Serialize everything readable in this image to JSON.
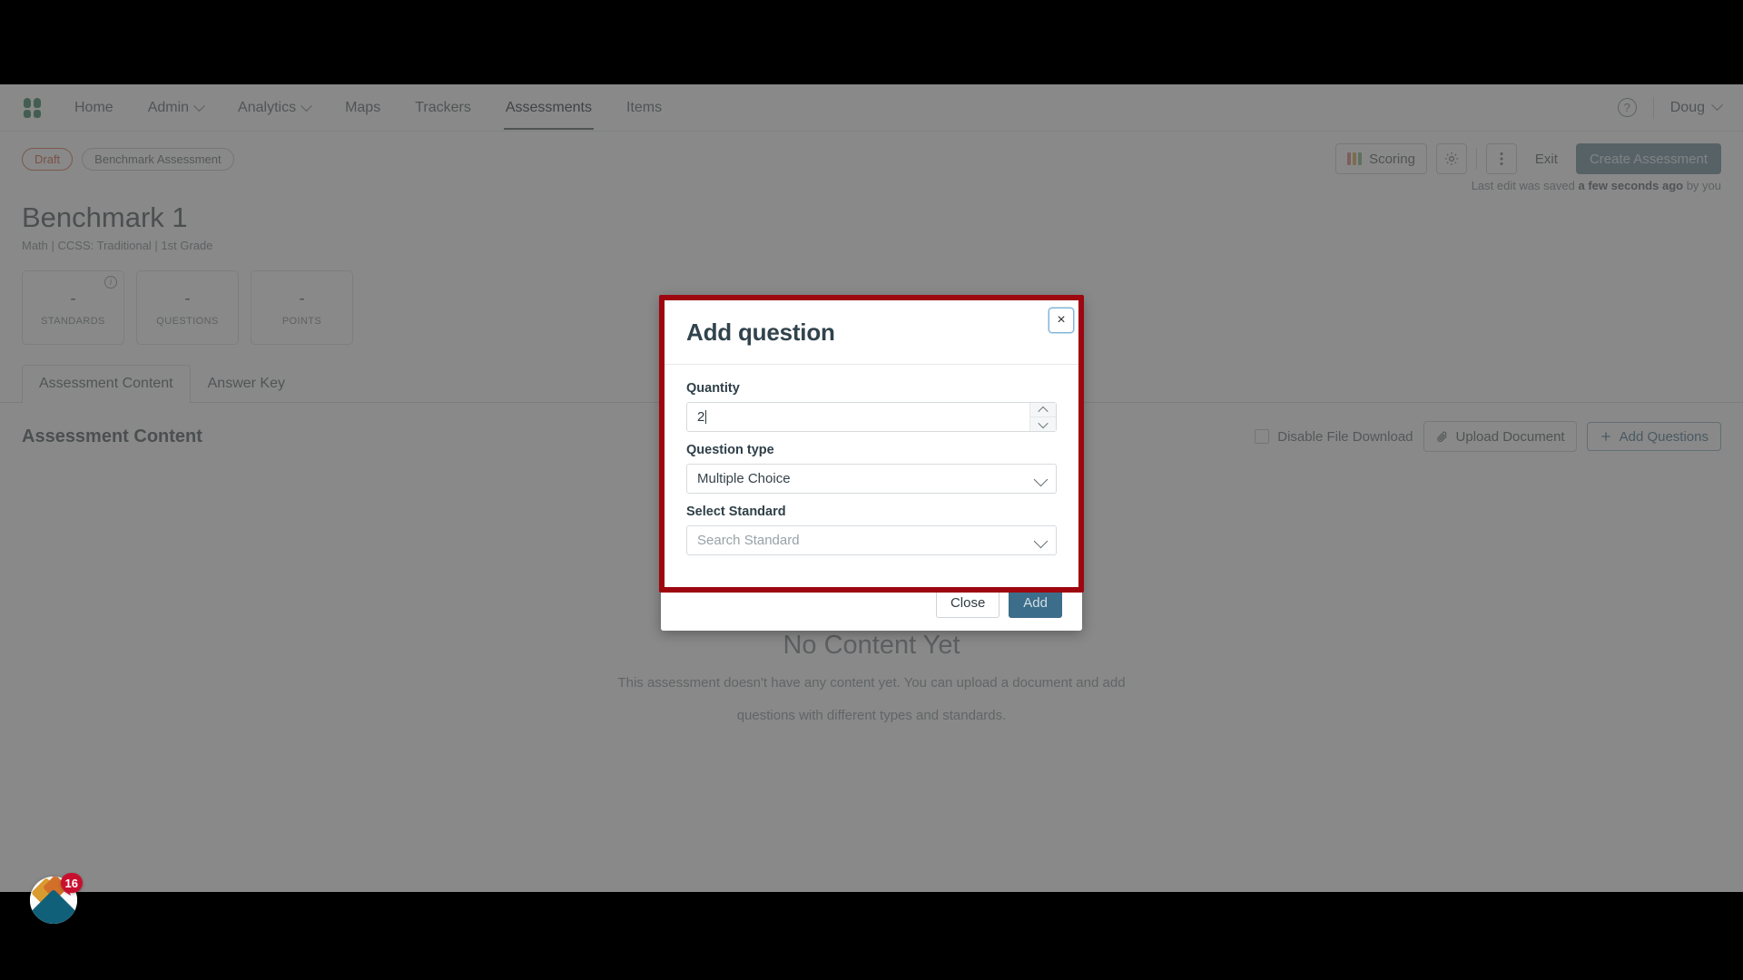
{
  "nav": {
    "logo_name": "app-logo",
    "items": [
      {
        "label": "Home",
        "has_caret": false,
        "active": false
      },
      {
        "label": "Admin",
        "has_caret": true,
        "active": false
      },
      {
        "label": "Analytics",
        "has_caret": true,
        "active": false
      },
      {
        "label": "Maps",
        "has_caret": false,
        "active": false
      },
      {
        "label": "Trackers",
        "has_caret": false,
        "active": false
      },
      {
        "label": "Assessments",
        "has_caret": false,
        "active": true
      },
      {
        "label": "Items",
        "has_caret": false,
        "active": false
      }
    ],
    "help_label": "?",
    "user_label": "Doug"
  },
  "subheader": {
    "status_pill": "Draft",
    "type_pill": "Benchmark Assessment",
    "scoring_label": "Scoring",
    "gear_label": "gear",
    "kebab_label": "more",
    "exit_label": "Exit",
    "create_label": "Create Assessment",
    "saved_prefix": "Last edit was saved ",
    "saved_bold": "a few seconds ago",
    "saved_suffix": " by you"
  },
  "page": {
    "title": "Benchmark 1",
    "subtitle": "Math  |  CCSS: Traditional  |  1st Grade"
  },
  "stats": [
    {
      "value": "-",
      "label": "STANDARDS",
      "has_info": true
    },
    {
      "value": "-",
      "label": "QUESTIONS",
      "has_info": false
    },
    {
      "value": "-",
      "label": "POINTS",
      "has_info": false
    }
  ],
  "tabs": [
    {
      "label": "Assessment Content",
      "active": true
    },
    {
      "label": "Answer Key",
      "active": false
    }
  ],
  "content": {
    "heading": "Assessment Content",
    "disable_download_label": "Disable File Download",
    "upload_label": "Upload Document",
    "add_questions_label": "Add Questions"
  },
  "empty": {
    "title": "No Content Yet",
    "line1": "This assessment doesn't have any content yet. You can upload a document and add",
    "line2": "questions with different types and standards."
  },
  "fab": {
    "badge_count": "16"
  },
  "modal": {
    "title": "Add question",
    "close_glyph": "×",
    "quantity_label": "Quantity",
    "quantity_value": "2",
    "question_type_label": "Question type",
    "question_type_value": "Multiple Choice",
    "select_standard_label": "Select Standard",
    "select_standard_placeholder": "Search Standard",
    "close_button": "Close",
    "add_button": "Add"
  },
  "colors": {
    "highlight": "#9e0710",
    "primary": "#3c6d8a",
    "draft": "#cf6c4e",
    "logo_green": "#4a8b6f",
    "badge_red": "#c8102e"
  }
}
